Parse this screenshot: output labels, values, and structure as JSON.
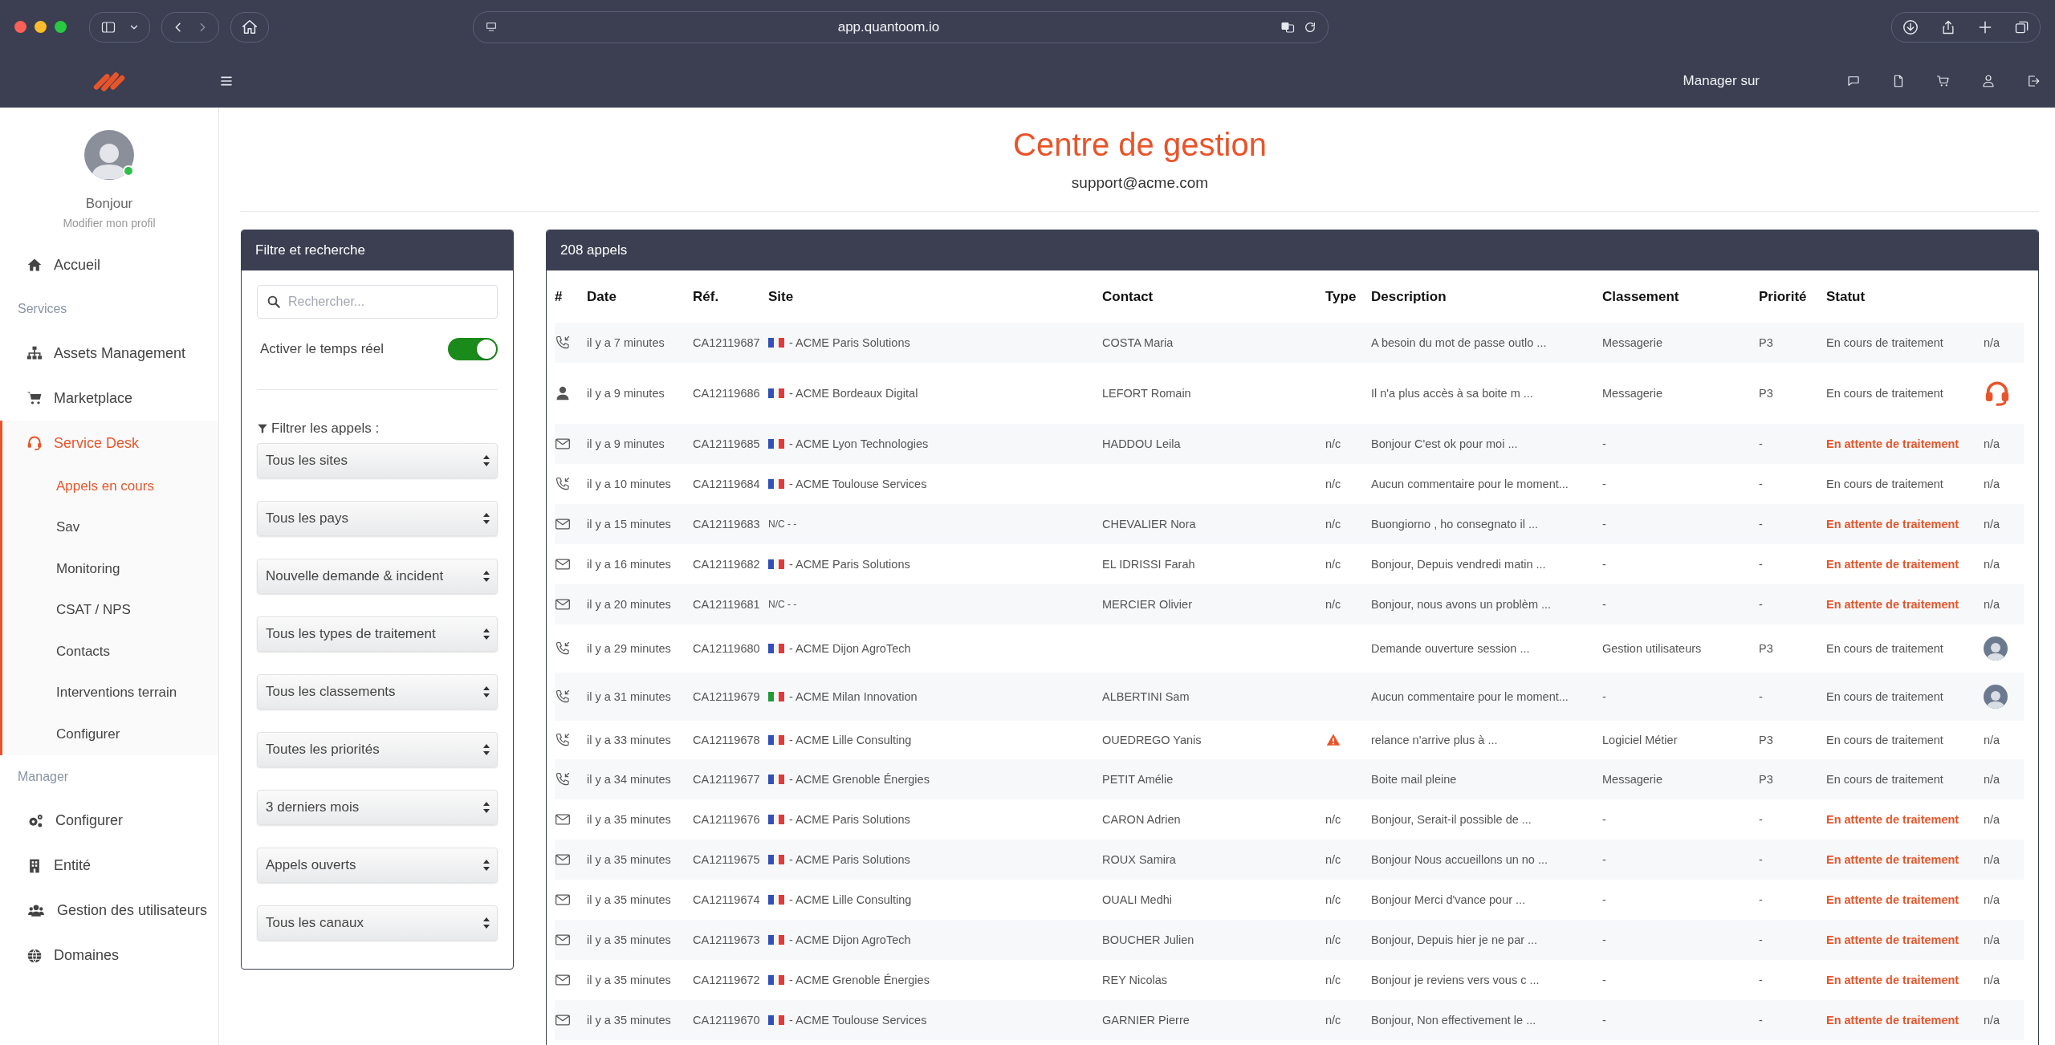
{
  "browser": {
    "url": "app.quantoom.io"
  },
  "topbar": {
    "manager_label": "Manager sur"
  },
  "user": {
    "greeting": "Bonjour",
    "profile_link": "Modifier mon profil",
    "online": true
  },
  "nav": [
    {
      "kind": "item",
      "label": "Accueil",
      "selected": false
    },
    {
      "kind": "section",
      "label": "Services"
    },
    {
      "kind": "item",
      "label": "Assets Management",
      "selected": false
    },
    {
      "kind": "item",
      "label": "Marketplace",
      "selected": false
    },
    {
      "kind": "item",
      "label": "Service Desk",
      "selected": true,
      "expanded": true,
      "children": [
        {
          "label": "Appels en cours",
          "selected": true
        },
        {
          "label": "Sav",
          "selected": false
        },
        {
          "label": "Monitoring",
          "selected": false
        },
        {
          "label": "CSAT / NPS",
          "selected": false
        },
        {
          "label": "Contacts",
          "selected": false
        },
        {
          "label": "Interventions terrain",
          "selected": false
        },
        {
          "label": "Configurer",
          "selected": false
        }
      ]
    },
    {
      "kind": "section",
      "label": "Manager"
    },
    {
      "kind": "item",
      "label": "Configurer",
      "selected": false
    },
    {
      "kind": "item",
      "label": "Entité",
      "selected": false
    },
    {
      "kind": "item",
      "label": "Gestion des utilisateurs",
      "selected": false
    },
    {
      "kind": "item",
      "label": "Domaines",
      "selected": false
    }
  ],
  "page": {
    "title": "Centre de gestion",
    "subtitle": "support@acme.com"
  },
  "filter": {
    "title": "Filtre et recherche",
    "search_placeholder": "Rechercher...",
    "realtime_label": "Activer le temps réel",
    "realtime_on": true,
    "filters_label": "Filtrer les appels :",
    "selects": [
      "Tous les sites",
      "Tous les pays",
      "Nouvelle demande & incident",
      "Tous les types de traitement",
      "Tous les classements",
      "Toutes les priorités",
      "3 derniers mois",
      "Appels ouverts",
      "Tous les canaux"
    ]
  },
  "table": {
    "title": "208 appels",
    "columns": [
      "#",
      "Date",
      "Réf.",
      "Site",
      "Contact",
      "Type",
      "Description",
      "Classement",
      "Priorité",
      "Statut"
    ],
    "rows": [
      {
        "kind": "phone",
        "date": "il y a 7 minutes",
        "ref": "CA12119687",
        "site_flag": {
          "kind": "fr"
        },
        "site": "-  ACME Paris Solutions",
        "contact": "COSTA Maria",
        "flagged": false,
        "description": "A besoin du mot de passe outlo ...",
        "category": "Messagerie",
        "priority": "P3",
        "status": "En cours de traitement",
        "pending": false,
        "assignee": {
          "kind": "text",
          "text": "n/a"
        }
      },
      {
        "kind": "person",
        "date": "il y a 9 minutes",
        "ref": "CA12119686",
        "site_flag": {
          "kind": "fr"
        },
        "site": "-  ACME Bordeaux Digital",
        "contact": "LEFORT Romain",
        "flagged": false,
        "description": "Il n'a plus accès à sa boite m ...",
        "category": "Messagerie",
        "priority": "P3",
        "status": "En cours de traitement",
        "pending": false,
        "assignee": {
          "kind": "headset"
        }
      },
      {
        "kind": "mail",
        "date": "il y a 9 minutes",
        "ref": "CA12119685",
        "site_flag": {
          "kind": "fr"
        },
        "site": "- ACME Lyon  Technologies",
        "contact": "HADDOU Leila",
        "type": "n/c",
        "flagged": false,
        "description": "Bonjour C'est ok pour moi ...",
        "category": "-",
        "priority": "-",
        "status": "En attente de traitement",
        "pending": true,
        "assignee": {
          "kind": "text",
          "text": "n/a"
        }
      },
      {
        "kind": "phone",
        "date": "il y a 10 minutes",
        "ref": "CA12119684",
        "site_flag": {
          "kind": "fr"
        },
        "site": "-  ACME Toulouse Services",
        "type": "n/c",
        "flagged": false,
        "description": "Aucun commentaire pour le moment...",
        "category": "-",
        "priority": "-",
        "status": "En cours de traitement",
        "pending": false,
        "assignee": {
          "kind": "text",
          "text": "n/a"
        }
      },
      {
        "kind": "mail",
        "date": "il y a 15 minutes",
        "ref": "CA12119683",
        "site": "N/C - -",
        "contact": "CHEVALIER Nora",
        "type": "n/c",
        "flagged": false,
        "description": "Buongiorno , ho consegnato il ...",
        "category": "-",
        "priority": "-",
        "status": "En attente de traitement",
        "pending": true,
        "assignee": {
          "kind": "text",
          "text": "n/a"
        }
      },
      {
        "kind": "mail",
        "date": "il y a 16 minutes",
        "ref": "CA12119682",
        "site_flag": {
          "kind": "fr"
        },
        "site": "-  ACME Paris Solutions",
        "contact": "EL IDRISSI Farah",
        "type": "n/c",
        "flagged": false,
        "description": "Bonjour, Depuis vendredi matin ...",
        "category": "-",
        "priority": "-",
        "status": "En attente de traitement",
        "pending": true,
        "assignee": {
          "kind": "text",
          "text": "n/a"
        }
      },
      {
        "kind": "mail",
        "date": "il y a 20 minutes",
        "ref": "CA12119681",
        "site": "N/C - -",
        "contact": "MERCIER Olivier",
        "type": "n/c",
        "flagged": false,
        "description": "Bonjour, nous avons un problèm ...",
        "category": "-",
        "priority": "-",
        "status": "En attente de traitement",
        "pending": true,
        "assignee": {
          "kind": "text",
          "text": "n/a"
        }
      },
      {
        "kind": "phone",
        "date": "il y a 29 minutes",
        "ref": "CA12119680",
        "site_flag": {
          "kind": "fr"
        },
        "site": "-  ACME Dijon AgroTech",
        "flagged": false,
        "description": "Demande ouverture session ...",
        "category": "Gestion utilisateurs",
        "priority": "P3",
        "status": "En cours de traitement",
        "pending": false,
        "assignee": {
          "kind": "avatar"
        }
      },
      {
        "kind": "phone",
        "date": "il y a 31 minutes",
        "ref": "CA12119679",
        "site_flag": {
          "kind": "it"
        },
        "site": "-  ACME Milan Innovation",
        "contact": "ALBERTINI Sam",
        "flagged": false,
        "description": "Aucun commentaire pour le moment...",
        "category": "-",
        "priority": "-",
        "status": "En cours de traitement",
        "pending": false,
        "assignee": {
          "kind": "avatar"
        }
      },
      {
        "kind": "phone",
        "date": "il y a 33 minutes",
        "ref": "CA12119678",
        "site_flag": {
          "kind": "fr"
        },
        "site": "- ACME Lille Consulting",
        "contact": "OUEDREGO Yanis",
        "flagged": true,
        "description": "relance n'arrive plus à ...",
        "category": "Logiciel Métier",
        "priority": "P3",
        "status": "En cours de traitement",
        "pending": false,
        "assignee": {
          "kind": "text",
          "text": "n/a"
        }
      },
      {
        "kind": "phone",
        "date": "il y a 34 minutes",
        "ref": "CA12119677",
        "site_flag": {
          "kind": "fr"
        },
        "site": "- ACME Grenoble Énergies",
        "contact": "PETIT Amélie",
        "flagged": false,
        "description": "Boite mail pleine",
        "category": "Messagerie",
        "priority": "P3",
        "status": "En cours de traitement",
        "pending": false,
        "assignee": {
          "kind": "text",
          "text": "n/a"
        }
      },
      {
        "kind": "mail",
        "date": "il y a 35 minutes",
        "ref": "CA12119676",
        "site_flag": {
          "kind": "fr"
        },
        "site": "- ACME Paris Solutions",
        "contact": "CARON Adrien",
        "type": "n/c",
        "flagged": false,
        "description": "Bonjour, Serait-il possible de ...",
        "category": "-",
        "priority": "-",
        "status": "En attente de traitement",
        "pending": true,
        "assignee": {
          "kind": "text",
          "text": "n/a"
        }
      },
      {
        "kind": "mail",
        "date": "il y a 35 minutes",
        "ref": "CA12119675",
        "site_flag": {
          "kind": "fr"
        },
        "site": "- ACME Paris Solutions",
        "contact": "ROUX Samira",
        "type": "n/c",
        "flagged": false,
        "description": "Bonjour Nous accueillons un no ...",
        "category": "-",
        "priority": "-",
        "status": "En attente de traitement",
        "pending": true,
        "assignee": {
          "kind": "text",
          "text": "n/a"
        }
      },
      {
        "kind": "mail",
        "date": "il y a 35 minutes",
        "ref": "CA12119674",
        "site_flag": {
          "kind": "fr"
        },
        "site": "- ACME Lille Consulting",
        "contact": "OUALI Medhi",
        "type": "n/c",
        "flagged": false,
        "description": "Bonjour Merci d'vance pour ...",
        "category": "-",
        "priority": "-",
        "status": "En attente de traitement",
        "pending": true,
        "assignee": {
          "kind": "text",
          "text": "n/a"
        }
      },
      {
        "kind": "mail",
        "date": "il y a 35 minutes",
        "ref": "CA12119673",
        "site_flag": {
          "kind": "fr"
        },
        "site": "- ACME Dijon AgroTech",
        "contact": "BOUCHER Julien",
        "type": "n/c",
        "flagged": false,
        "description": "Bonjour, Depuis hier je ne par ...",
        "category": "-",
        "priority": "-",
        "status": "En attente de traitement",
        "pending": true,
        "assignee": {
          "kind": "text",
          "text": "n/a"
        }
      },
      {
        "kind": "mail",
        "date": "il y a 35 minutes",
        "ref": "CA12119672",
        "site_flag": {
          "kind": "fr"
        },
        "site": "- ACME Grenoble Énergies",
        "contact": "REY Nicolas",
        "type": "n/c",
        "flagged": false,
        "description": "Bonjour je reviens vers vous c ...",
        "category": "-",
        "priority": "-",
        "status": "En attente de traitement",
        "pending": true,
        "assignee": {
          "kind": "text",
          "text": "n/a"
        }
      },
      {
        "kind": "mail",
        "date": "il y a 35 minutes",
        "ref": "CA12119670",
        "site_flag": {
          "kind": "fr"
        },
        "site": "- ACME Toulouse Services",
        "contact": "GARNIER Pierre",
        "type": "n/c",
        "flagged": false,
        "description": "Bonjour, Non effectivement le ...",
        "category": "-",
        "priority": "-",
        "status": "En attente de traitement",
        "pending": true,
        "assignee": {
          "kind": "text",
          "text": "n/a"
        }
      }
    ]
  }
}
